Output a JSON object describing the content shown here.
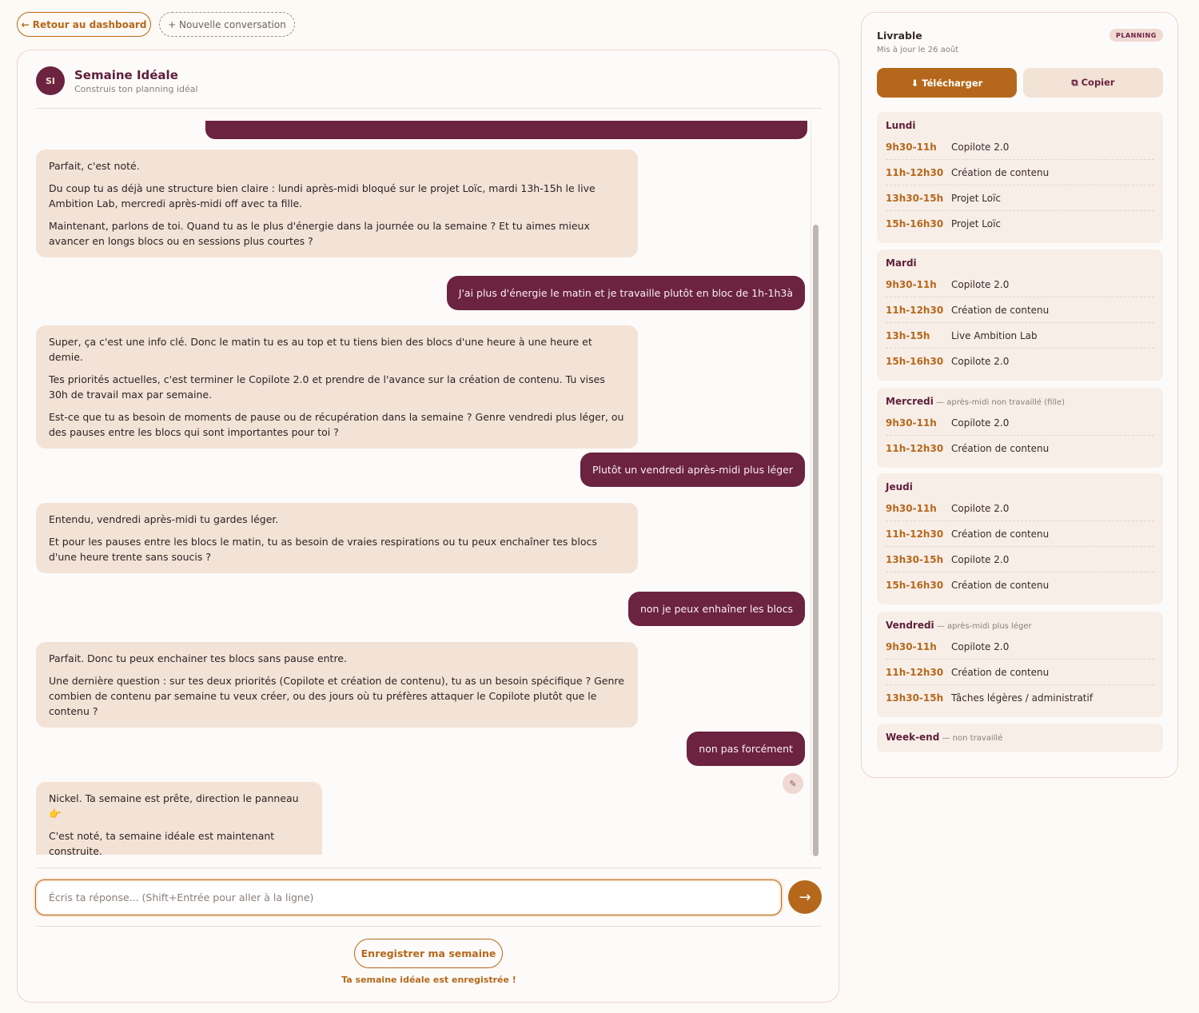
{
  "nav": {
    "back_label": "← Retour au dashboard",
    "new_label": "+ Nouvelle conversation"
  },
  "chat": {
    "avatar": "SI",
    "title": "Semaine Idéale",
    "subtitle": "Construis ton planning idéal",
    "messages": [
      {
        "role": "bot",
        "paragraphs": [
          "Parfait, c'est noté.",
          "Du coup tu as déjà une structure bien claire : lundi après-midi bloqué sur le projet Loïc, mardi 13h-15h le live Ambition Lab, mercredi après-midi off avec ta fille.",
          "Maintenant, parlons de toi. Quand tu as le plus d'énergie dans la journée ou la semaine ? Et tu aimes mieux avancer en longs blocs ou en sessions plus courtes ?"
        ]
      },
      {
        "role": "user",
        "text": "J'ai plus d'énergie le matin et je travaille plutôt en bloc de 1h-1h3à"
      },
      {
        "role": "bot",
        "paragraphs": [
          "Super, ça c'est une info clé. Donc le matin tu es au top et tu tiens bien des blocs d'une heure à une heure et demie.",
          "Tes priorités actuelles, c'est terminer le Copilote 2.0 et prendre de l'avance sur la création de contenu. Tu vises 30h de travail max par semaine.",
          "Est-ce que tu as besoin de moments de pause ou de récupération dans la semaine ? Genre vendredi plus léger, ou des pauses entre les blocs qui sont importantes pour toi ?"
        ]
      },
      {
        "role": "user",
        "text": "Plutôt un vendredi après-midi plus léger"
      },
      {
        "role": "bot",
        "paragraphs": [
          "Entendu, vendredi après-midi tu gardes léger.",
          "Et pour les pauses entre les blocs le matin, tu as besoin de vraies respirations ou tu peux enchaîner tes blocs d'une heure trente sans soucis ?"
        ]
      },
      {
        "role": "user",
        "text": "non je peux enhaîner les blocs"
      },
      {
        "role": "bot",
        "paragraphs": [
          "Parfait. Donc tu peux enchainer tes blocs sans pause entre.",
          "Une dernière question : sur tes deux priorités (Copilote et création de contenu), tu as un besoin spécifique ? Genre combien de contenu par semaine tu veux créer, ou des jours où tu préfères attaquer le Copilote plutôt que le contenu ?"
        ]
      },
      {
        "role": "user",
        "text": "non pas forcément"
      },
      {
        "role": "bot",
        "paragraphs": [
          "Nickel. Ta semaine est prête, direction le panneau 👉",
          "C'est noté, ta semaine idéale est maintenant construite."
        ]
      }
    ],
    "input_placeholder": "Écris ta réponse... (Shift+Entrée pour aller à la ligne)",
    "send_icon": "→",
    "edit_icon": "✎",
    "save_label": "Enregistrer ma semaine",
    "saved_notice": "Ta semaine idéale est enregistrée !"
  },
  "deliverable": {
    "title": "Livrable",
    "updated": "Mis à jour le 26 août",
    "badge": "PLANNING",
    "download_label": "⬇ Télécharger",
    "copy_label": "⧉ Copier",
    "days": [
      {
        "name": "Lundi",
        "note": "",
        "slots": [
          {
            "time": "9h30-11h",
            "task": "Copilote 2.0"
          },
          {
            "time": "11h-12h30",
            "task": "Création de contenu"
          },
          {
            "time": "13h30-15h",
            "task": "Projet Loïc"
          },
          {
            "time": "15h-16h30",
            "task": "Projet Loïc"
          }
        ]
      },
      {
        "name": "Mardi",
        "note": "",
        "slots": [
          {
            "time": "9h30-11h",
            "task": "Copilote 2.0"
          },
          {
            "time": "11h-12h30",
            "task": "Création de contenu"
          },
          {
            "time": "13h-15h",
            "task": "Live Ambition Lab"
          },
          {
            "time": "15h-16h30",
            "task": "Copilote 2.0"
          }
        ]
      },
      {
        "name": "Mercredi",
        "note": " — après-midi non travaillé (fille)",
        "slots": [
          {
            "time": "9h30-11h",
            "task": "Copilote 2.0"
          },
          {
            "time": "11h-12h30",
            "task": "Création de contenu"
          }
        ]
      },
      {
        "name": "Jeudi",
        "note": "",
        "slots": [
          {
            "time": "9h30-11h",
            "task": "Copilote 2.0"
          },
          {
            "time": "11h-12h30",
            "task": "Création de contenu"
          },
          {
            "time": "13h30-15h",
            "task": "Copilote 2.0"
          },
          {
            "time": "15h-16h30",
            "task": "Création de contenu"
          }
        ]
      },
      {
        "name": "Vendredi",
        "note": " — après-midi plus léger",
        "slots": [
          {
            "time": "9h30-11h",
            "task": "Copilote 2.0"
          },
          {
            "time": "11h-12h30",
            "task": "Création de contenu"
          },
          {
            "time": "13h30-15h",
            "task": "Tâches légères / administratif"
          }
        ]
      },
      {
        "name": "Week-end",
        "note": " — non travaillé",
        "slots": []
      }
    ]
  },
  "colors": {
    "accent": "#b5681b",
    "brand": "#6b2340",
    "bot_bubble": "#f3e2d6"
  }
}
